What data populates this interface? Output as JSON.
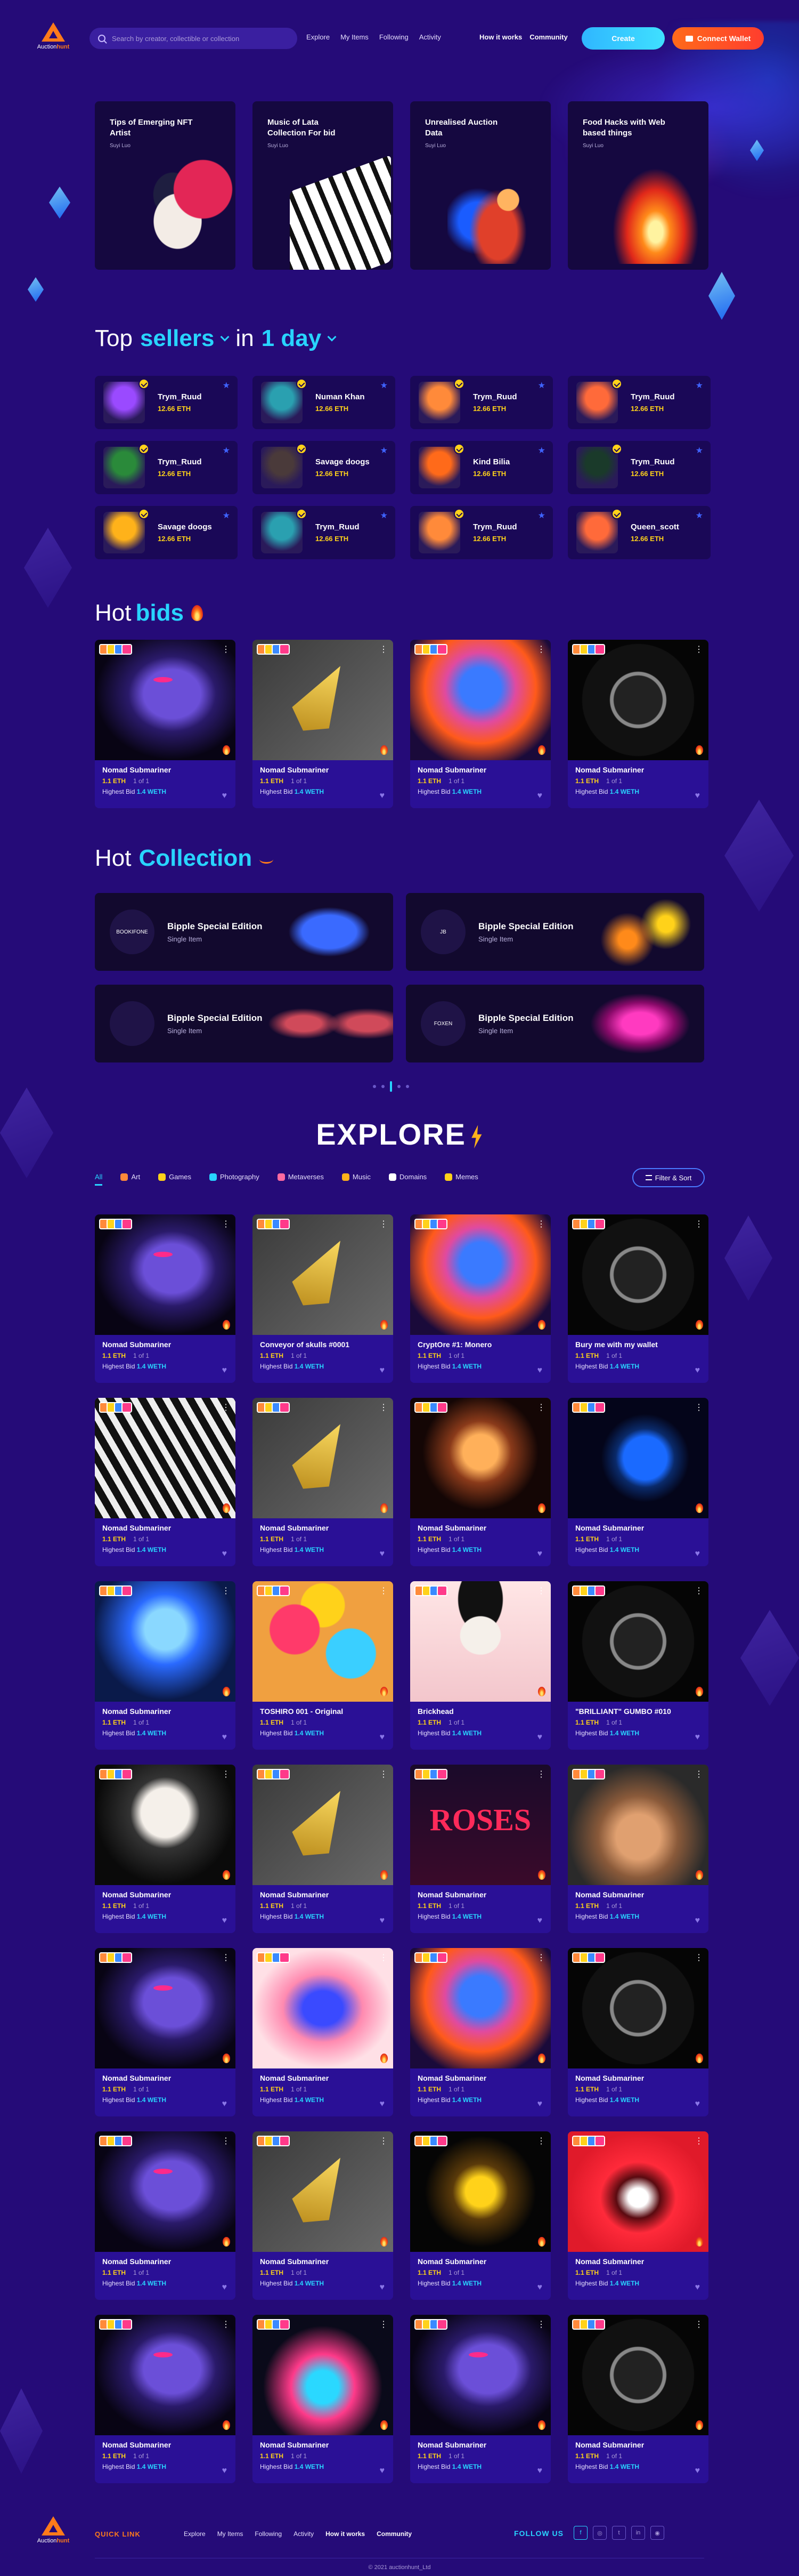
{
  "header": {
    "logo_text_1": "Auction",
    "logo_text_2": "hunt",
    "search_placeholder": "Search by creator, collectible or collection",
    "nav": [
      "Explore",
      "My Items",
      "Following",
      "Activity"
    ],
    "nav2": [
      "How it works",
      "Community"
    ],
    "create": "Create",
    "wallet": "Connect Wallet"
  },
  "featured": [
    {
      "title": "Tips of Emerging NFT Artist",
      "author": "Suyi Luo",
      "art": "art-geisha"
    },
    {
      "title": "Music of Lata Collection For bid",
      "author": "Suyi Luo",
      "art": "art-piano"
    },
    {
      "title": "Unrealised Auction Data",
      "author": "Suyi Luo",
      "art": "art-gavel"
    },
    {
      "title": "Food Hacks with Web based things",
      "author": "Suyi Luo",
      "art": "art-fire"
    }
  ],
  "sellers_title": {
    "t1": "Top",
    "t2": "sellers",
    "t3": "in",
    "t4": "1 day"
  },
  "sellers": [
    {
      "name": "Trym_Ruud",
      "eth": "12.66 ETH",
      "color": "#9a4aff"
    },
    {
      "name": "Numan Khan",
      "eth": "12.66 ETH",
      "color": "#2aa0b0"
    },
    {
      "name": "Trym_Ruud",
      "eth": "12.66 ETH",
      "color": "#ff8a3a"
    },
    {
      "name": "Trym_Ruud",
      "eth": "12.66 ETH",
      "color": "#ff6a3a"
    },
    {
      "name": "Trym_Ruud",
      "eth": "12.66 ETH",
      "color": "#2a8a3a"
    },
    {
      "name": "Savage doogs",
      "eth": "12.66 ETH",
      "color": "#4a3a3a"
    },
    {
      "name": "Kind Bilia",
      "eth": "12.66 ETH",
      "color": "#ff6a1a"
    },
    {
      "name": "Trym_Ruud",
      "eth": "12.66 ETH",
      "color": "#1a3a2a"
    },
    {
      "name": "Savage doogs",
      "eth": "12.66 ETH",
      "color": "#ffb21a"
    },
    {
      "name": "Trym_Ruud",
      "eth": "12.66 ETH",
      "color": "#2aa0b0"
    },
    {
      "name": "Trym_Ruud",
      "eth": "12.66 ETH",
      "color": "#ff8a3a"
    },
    {
      "name": "Queen_scott",
      "eth": "12.66 ETH",
      "color": "#ff6a3a"
    }
  ],
  "hot_bids_title": {
    "t1": "Hot",
    "t2": "bids"
  },
  "price_label": "1.1 ETH",
  "stock_label": "1 of 1",
  "bid_label": "Highest Bid",
  "bid_value": "1.4 WETH",
  "hot_bids": [
    {
      "name": "Nomad Submariner",
      "img": "im-face"
    },
    {
      "name": "Nomad Submariner",
      "img": "im-shuttle"
    },
    {
      "name": "Nomad Submariner",
      "img": "im-orange"
    },
    {
      "name": "Nomad Submariner",
      "img": "im-watch"
    }
  ],
  "hot_collection_title": {
    "t1": "Hot",
    "t2": "Collection"
  },
  "collections": [
    {
      "title": "Bipple Special Edition",
      "sub": "Single Item",
      "logo": "BOOKIFONE",
      "art": "ca-1"
    },
    {
      "title": "Bipple Special Edition",
      "sub": "Single Item",
      "logo": "JB",
      "art": "ca-2"
    },
    {
      "title": "Bipple Special Edition",
      "sub": "Single Item",
      "logo": "",
      "art": "ca-3"
    },
    {
      "title": "Bipple Special Edition",
      "sub": "Single Item",
      "logo": "FOXEN",
      "art": "ca-4"
    }
  ],
  "explore_title": "EXPLORE",
  "filters": [
    {
      "label": "All",
      "color": ""
    },
    {
      "label": "Art",
      "color": "#ff8a3a"
    },
    {
      "label": "Games",
      "color": "#ffd21a"
    },
    {
      "label": "Photography",
      "color": "#28d4ff"
    },
    {
      "label": "Metaverses",
      "color": "#ff6aa0"
    },
    {
      "label": "Music",
      "color": "#ffb21a"
    },
    {
      "label": "Domains",
      "color": "#ffffff"
    },
    {
      "label": "Memes",
      "color": "#ffd21a"
    }
  ],
  "filter_sort": "Filter & Sort",
  "explore": [
    {
      "name": "Nomad Submariner",
      "img": "im-face"
    },
    {
      "name": "Conveyor of skulls #0001",
      "img": "im-shuttle"
    },
    {
      "name": "CryptOre #1: Monero",
      "img": "im-orange"
    },
    {
      "name": "Bury me with my wallet",
      "img": "im-watch"
    },
    {
      "name": "Nomad Submariner",
      "img": "im-zebra"
    },
    {
      "name": "Nomad Submariner",
      "img": "im-shuttle"
    },
    {
      "name": "Nomad Submariner",
      "img": "im-brain"
    },
    {
      "name": "Nomad Submariner",
      "img": "im-earth"
    },
    {
      "name": "Nomad Submariner",
      "img": "im-brain2"
    },
    {
      "name": "TOSHIRO 001 - Original",
      "img": "im-toshiro"
    },
    {
      "name": "Brickhead",
      "img": "im-skull"
    },
    {
      "name": "\"BRILLIANT\" GUMBO #010",
      "img": "im-watch"
    },
    {
      "name": "Nomad Submariner",
      "img": "im-mask"
    },
    {
      "name": "Nomad Submariner",
      "img": "im-shuttle"
    },
    {
      "name": "Nomad Submariner",
      "img": "im-roses"
    },
    {
      "name": "Nomad Submariner",
      "img": "im-heels"
    },
    {
      "name": "Nomad Submariner",
      "img": "im-face"
    },
    {
      "name": "Nomad Submariner",
      "img": "im-leaf"
    },
    {
      "name": "Nomad Submariner",
      "img": "im-orange"
    },
    {
      "name": "Nomad Submariner",
      "img": "im-watch"
    },
    {
      "name": "Nomad Submariner",
      "img": "im-face"
    },
    {
      "name": "Nomad Submariner",
      "img": "im-shuttle"
    },
    {
      "name": "Nomad Submariner",
      "img": "im-trophy"
    },
    {
      "name": "Nomad Submariner",
      "img": "im-mouth"
    },
    {
      "name": "Nomad Submariner",
      "img": "im-face"
    },
    {
      "name": "Nomad Submariner",
      "img": "im-plant"
    },
    {
      "name": "Nomad Submariner",
      "img": "im-face"
    },
    {
      "name": "Nomad Submariner",
      "img": "im-watch"
    }
  ],
  "footer": {
    "quick": "QUICK LINK",
    "nav": [
      "Explore",
      "My Items",
      "Following",
      "Activity"
    ],
    "nav2": [
      "How it works",
      "Community"
    ],
    "follow": "FOLLOW US",
    "copyright": "© 2021 auctionhunt_Ltd"
  }
}
